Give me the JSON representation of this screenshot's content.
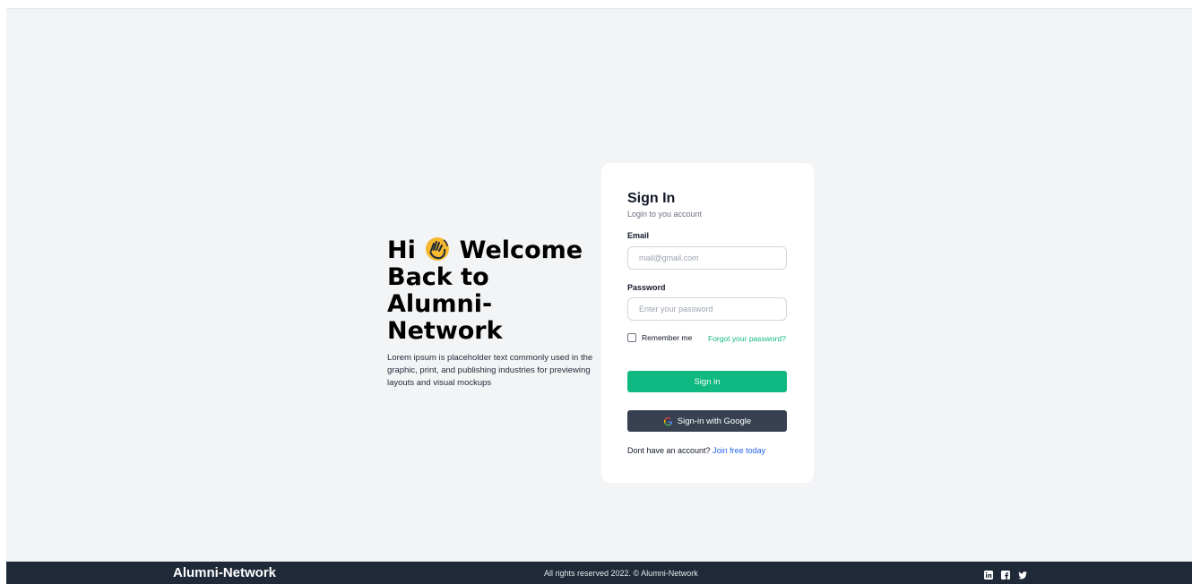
{
  "hero": {
    "title_part1": "Hi",
    "title_part2": "Welcome Back to Alumni-Network",
    "description": "Lorem ipsum is placeholder text commonly used in the graphic, print, and publishing industries for previewing layouts and visual mockups",
    "icon": "waving-hand-icon"
  },
  "login": {
    "title": "Sign In",
    "subtitle": "Login to you account",
    "email_label": "Email",
    "email_placeholder": "mail@gmail.com",
    "password_label": "Password",
    "password_placeholder": "Enter your password",
    "remember_label": "Remember me",
    "forgot_label": "Forgot your password?",
    "signin_label": "Sign in",
    "google_label": "Sign-in with Google",
    "signup_prompt": "Dont have an account?",
    "signup_link": "Join free today"
  },
  "footer": {
    "brand": "Alumni-Network",
    "copyright": "All rights reserved 2022. © Alumni-Network",
    "social": [
      "linkedin-icon",
      "facebook-icon",
      "twitter-icon"
    ]
  },
  "colors": {
    "primary_green": "#10b981",
    "dark": "#1f2937",
    "button_dark": "#374151",
    "link_blue": "#2563eb",
    "background": "#f3f4f6"
  }
}
